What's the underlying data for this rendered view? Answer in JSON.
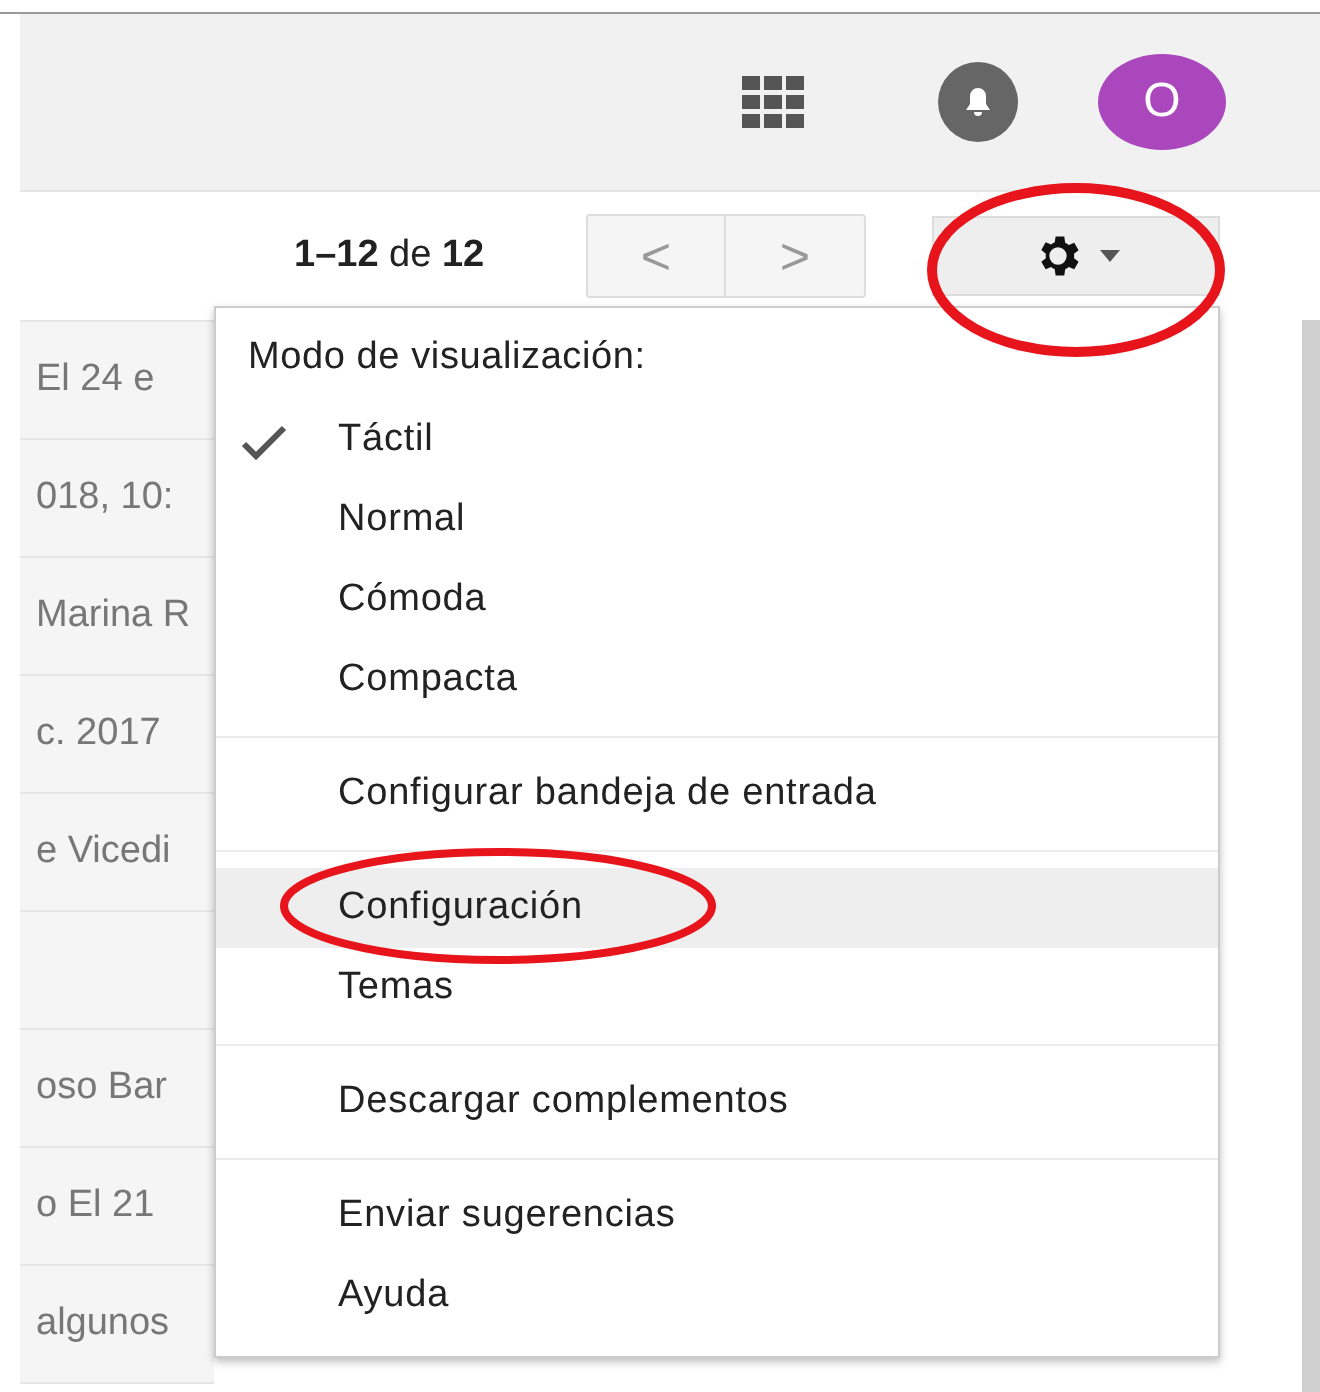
{
  "header": {
    "avatar": {
      "initial": "O",
      "color": "#ab47bc"
    }
  },
  "toolbar": {
    "pagination": "**1–12** de **12**",
    "prev": "<",
    "next": ">",
    "settings": {
      "circled": true
    }
  },
  "messages": [
    {
      "kind": "text",
      "snippet": "El 24 e"
    },
    {
      "kind": "text",
      "snippet": "018, 10:"
    },
    {
      "kind": "text",
      "snippet": "Marina R"
    },
    {
      "kind": "text",
      "snippet": "c. 2017"
    },
    {
      "kind": "text",
      "snippet": "e Vicedi"
    },
    {
      "kind": "blank"
    },
    {
      "kind": "text",
      "snippet": "oso Bar"
    },
    {
      "kind": "text",
      "snippet": "o El 21"
    },
    {
      "kind": "text",
      "snippet": "algunos"
    }
  ],
  "menu": {
    "heading": "Modo de visualización:",
    "sections": [
      [
        {
          "label": "Táctil",
          "checked": true,
          "selected": false,
          "circled": false
        },
        {
          "label": "Normal",
          "checked": false,
          "selected": false,
          "circled": false
        },
        {
          "label": "Cómoda",
          "checked": false,
          "selected": false,
          "circled": false
        },
        {
          "label": "Compacta",
          "checked": false,
          "selected": false,
          "circled": false
        }
      ],
      [
        {
          "label": "Configurar bandeja de entrada",
          "selected": false,
          "circled": false
        }
      ],
      [
        {
          "label": "Configuración",
          "selected": true,
          "circled": true
        },
        {
          "label": "Temas",
          "selected": false,
          "circled": false
        }
      ],
      [
        {
          "label": "Descargar complementos",
          "selected": false,
          "circled": false
        }
      ],
      [
        {
          "label": "Enviar sugerencias",
          "selected": false,
          "circled": false
        },
        {
          "label": "Ayuda",
          "selected": false,
          "circled": false
        }
      ]
    ]
  }
}
